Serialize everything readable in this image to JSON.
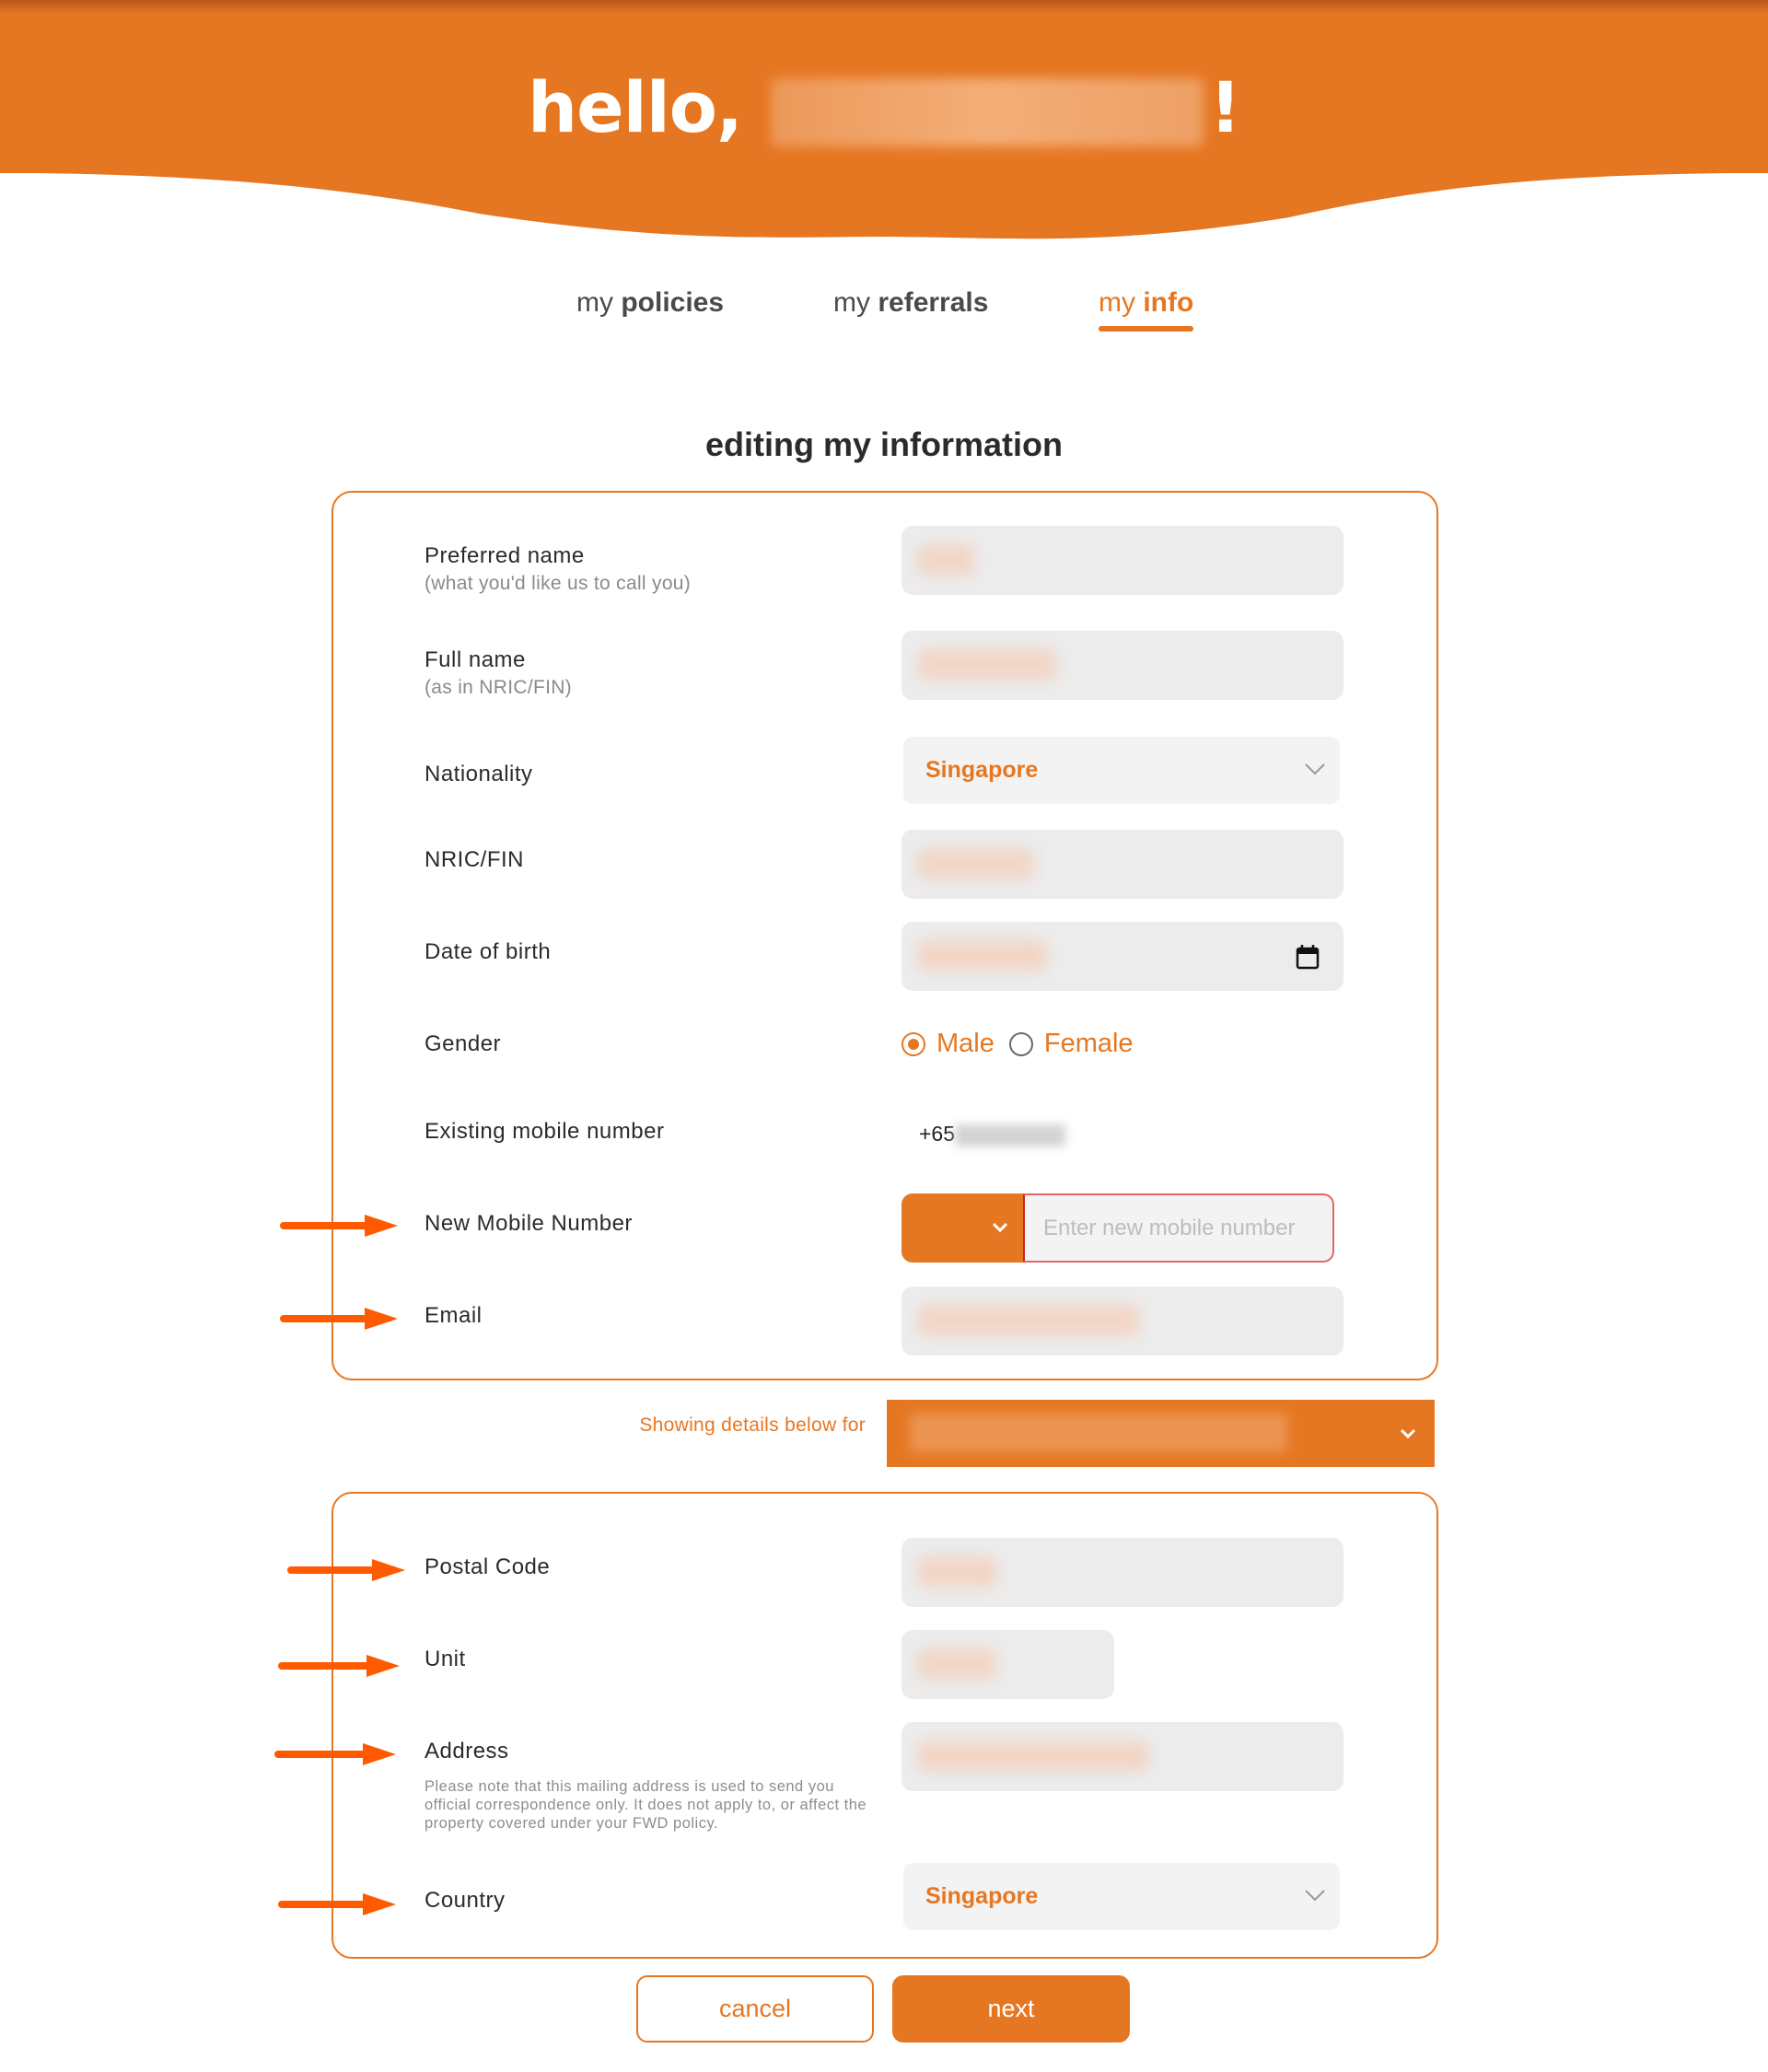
{
  "header": {
    "greeting": "hello,",
    "user_name_redacted": true,
    "exclamation": "!"
  },
  "colors": {
    "brand": "#e67722",
    "annotation_arrow": "#ff5a00",
    "field_bg": "#ececec",
    "error_border": "#e06666"
  },
  "tabs": [
    {
      "prefix": "my",
      "label": "policies",
      "active": false
    },
    {
      "prefix": "my",
      "label": "referrals",
      "active": false
    },
    {
      "prefix": "my",
      "label": "info",
      "active": true
    }
  ],
  "page_title": "editing my information",
  "personal_section": {
    "preferred_name": {
      "label": "Preferred name",
      "sublabel": "(what you'd like us to call you)",
      "value_redacted": true
    },
    "full_name": {
      "label": "Full name",
      "sublabel": "(as in NRIC/FIN)",
      "value_redacted": true
    },
    "nationality": {
      "label": "Nationality",
      "value": "Singapore"
    },
    "nric": {
      "label": "NRIC/FIN",
      "value_redacted": true
    },
    "dob": {
      "label": "Date of birth",
      "value_redacted": true,
      "icon": "calendar-icon"
    },
    "gender": {
      "label": "Gender",
      "options": [
        "Male",
        "Female"
      ],
      "selected": "Male"
    },
    "existing_mobile": {
      "label": "Existing mobile number",
      "prefix": "+65",
      "value_redacted": true
    },
    "new_mobile": {
      "label": "New Mobile Number",
      "placeholder": "Enter new mobile number",
      "country_code_icon": "chevron-down-icon"
    },
    "email": {
      "label": "Email",
      "value_redacted": true
    }
  },
  "showing_details": {
    "label": "Showing details below for",
    "selected_redacted": true
  },
  "address_section": {
    "postal_code": {
      "label": "Postal Code",
      "value_redacted": true
    },
    "unit": {
      "label": "Unit",
      "value_redacted": true
    },
    "address": {
      "label": "Address",
      "note": "Please note that this mailing address is used to send you official correspondence only. It does not apply to, or affect the property covered under your FWD policy.",
      "value_redacted": true
    },
    "country": {
      "label": "Country",
      "value": "Singapore"
    }
  },
  "buttons": {
    "cancel": "cancel",
    "next": "next"
  },
  "annotations": {
    "arrows_pointing_to": [
      "New Mobile Number",
      "Email",
      "Postal Code",
      "Unit",
      "Address",
      "Country"
    ]
  }
}
